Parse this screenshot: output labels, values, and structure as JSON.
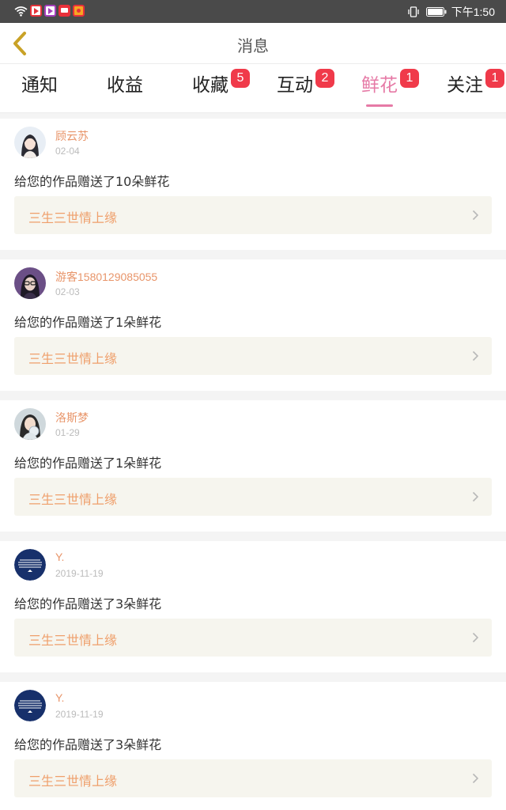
{
  "status_bar": {
    "time": "下午1:50",
    "icons": [
      "wifi-icon",
      "video-app-icon",
      "player-app-icon",
      "news-app-icon",
      "weibo-app-icon",
      "vibrate-icon",
      "battery-icon"
    ]
  },
  "header": {
    "title": "消息",
    "back_icon": "chevron-left-icon"
  },
  "tabs": [
    {
      "label": "通知",
      "badge": "",
      "active": false
    },
    {
      "label": "收益",
      "badge": "",
      "active": false
    },
    {
      "label": "收藏",
      "badge": "5",
      "active": false
    },
    {
      "label": "互动",
      "badge": "2",
      "active": false
    },
    {
      "label": "鲜花",
      "badge": "1",
      "active": true
    },
    {
      "label": "关注",
      "badge": "1",
      "active": false
    }
  ],
  "messages": [
    {
      "user": "顾云苏",
      "date": "02-04",
      "text": "给您的作品赠送了10朵鲜花",
      "work": "三生三世情上缘"
    },
    {
      "user": "游客1580129085055",
      "date": "02-03",
      "text": "给您的作品赠送了1朵鲜花",
      "work": "三生三世情上缘"
    },
    {
      "user": "洛斯梦",
      "date": "01-29",
      "text": "给您的作品赠送了1朵鲜花",
      "work": "三生三世情上缘"
    },
    {
      "user": "Y.",
      "date": "2019-11-19",
      "text": "给您的作品赠送了3朵鲜花",
      "work": "三生三世情上缘"
    },
    {
      "user": "Y.",
      "date": "2019-11-19",
      "text": "给您的作品赠送了3朵鲜花",
      "work": "三生三世情上缘"
    }
  ],
  "colors": {
    "accent_pink": "#e67aa6",
    "badge_red": "#f03a4a",
    "username_orange": "#e8956a",
    "work_title_orange": "#ef9f6b",
    "work_box_bg": "#f6f5ee",
    "back_arrow": "#c9a227"
  }
}
